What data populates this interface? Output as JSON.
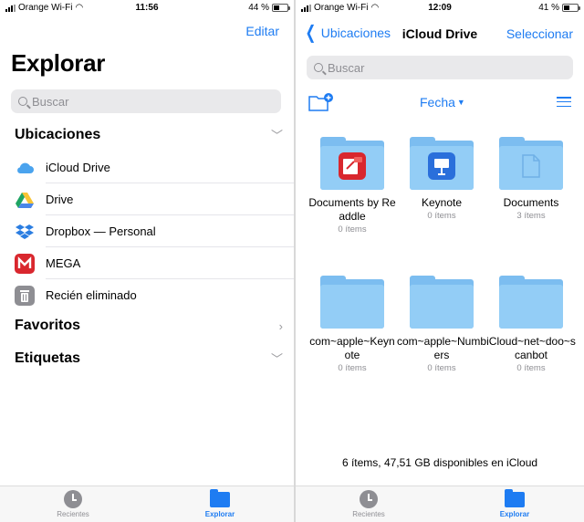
{
  "left": {
    "status": {
      "carrier": "Orange Wi-Fi",
      "time": "11:56",
      "battery": "44 %",
      "battery_level": 0.44
    },
    "edit_label": "Editar",
    "title": "Explorar",
    "search_placeholder": "Buscar",
    "locations_header": "Ubicaciones",
    "locations": [
      {
        "label": "iCloud Drive",
        "icon": "icloud-icon"
      },
      {
        "label": "Drive",
        "icon": "google-drive-icon"
      },
      {
        "label": "Dropbox — Personal",
        "icon": "dropbox-icon"
      },
      {
        "label": "MEGA",
        "icon": "mega-icon"
      },
      {
        "label": "Recién eliminado",
        "icon": "trash-icon"
      }
    ],
    "favorites_header": "Favoritos",
    "tags_header": "Etiquetas",
    "tabs": [
      {
        "label": "Recientes"
      },
      {
        "label": "Explorar"
      }
    ]
  },
  "right": {
    "status": {
      "carrier": "Orange Wi-Fi",
      "time": "12:09",
      "battery": "41 %",
      "battery_level": 0.41
    },
    "back_label": "Ubicaciones",
    "title": "iCloud Drive",
    "select_label": "Seleccionar",
    "search_placeholder": "Buscar",
    "sort_label": "Fecha",
    "items": [
      {
        "name": "Documents by Readdle",
        "meta": "0 ítems",
        "badge": "pdf-expert-icon"
      },
      {
        "name": "Keynote",
        "meta": "0 ítems",
        "badge": "keynote-icon"
      },
      {
        "name": "Documents",
        "meta": "3 ítems",
        "badge": "document-icon"
      },
      {
        "name": "com~apple~Keynote",
        "meta": "0 ítems",
        "badge": ""
      },
      {
        "name": "com~apple~Numbers",
        "meta": "0 ítems",
        "badge": ""
      },
      {
        "name": "iCloud~net~doo~scanbot",
        "meta": "0 ítems",
        "badge": ""
      }
    ],
    "footer": "6 ítems, 47,51 GB disponibles en iCloud",
    "tabs": [
      {
        "label": "Recientes"
      },
      {
        "label": "Explorar"
      }
    ]
  },
  "colors": {
    "accent": "#1e7cf2",
    "folder": "#93cdf6",
    "folder_back": "#7cbdf0",
    "secondary_text": "#8e8e93"
  }
}
